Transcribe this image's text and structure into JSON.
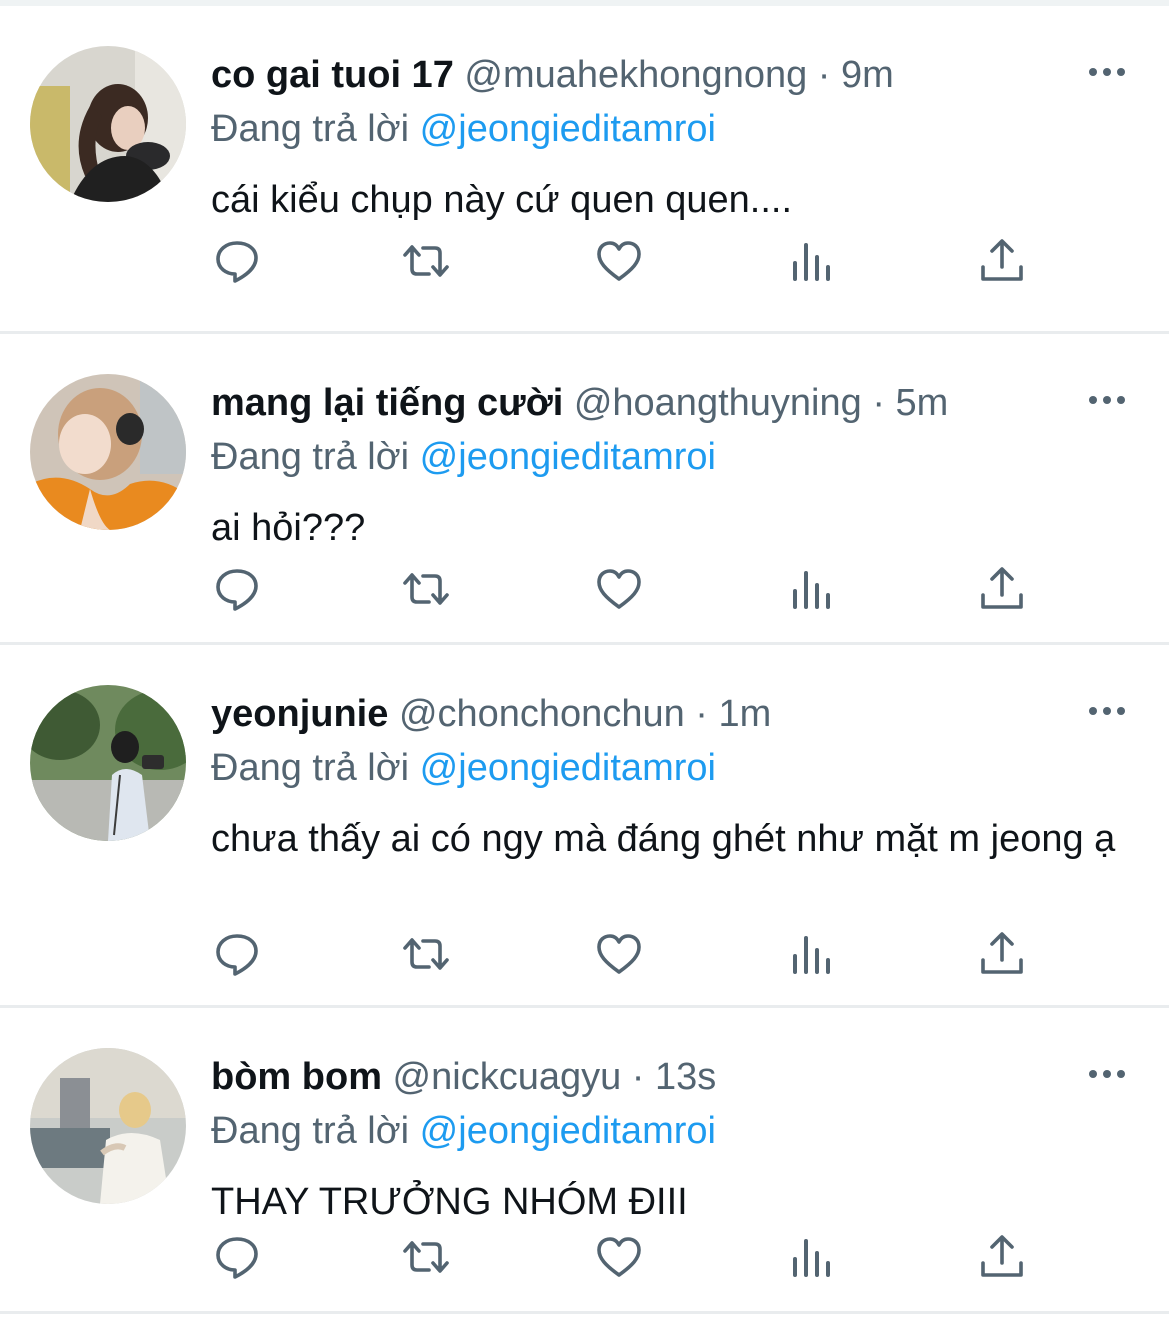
{
  "reply_prefix": "Đang trả lời",
  "tweets": [
    {
      "display_name": "co gai tuoi 17",
      "handle": "@muahekhongnong",
      "separator": "·",
      "time": "9m",
      "reply_to": "@jeongieditamroi",
      "text": "cái kiểu chụp này cứ quen quen....",
      "avatar": "avatar-girl-ponytail"
    },
    {
      "display_name": "mang lại tiếng cười",
      "handle": "@hoangthuyning",
      "separator": "·",
      "time": "5m",
      "reply_to": "@jeongieditamroi",
      "text": "ai hỏi???",
      "avatar": "avatar-girl-orange"
    },
    {
      "display_name": "yeonjunie",
      "handle": "@chonchonchun",
      "separator": "·",
      "time": "1m",
      "reply_to": "@jeongieditamroi",
      "text": "chưa thấy ai có ngy mà đáng ghét như mặt m jeong ạ",
      "avatar": "avatar-person-camera"
    },
    {
      "display_name": "bòm bom",
      "handle": "@nickcuagyu",
      "separator": "·",
      "time": "13s",
      "reply_to": "@jeongieditamroi",
      "text": "THAY TRƯỞNG NHÓM ĐIII",
      "avatar": "avatar-person-waterfront"
    }
  ],
  "icons": {
    "reply": "reply-icon",
    "retweet": "retweet-icon",
    "like": "heart-icon",
    "views": "analytics-icon",
    "share": "share-icon",
    "more": "more-options-icon"
  },
  "colors": {
    "text": "#0f1419",
    "secondary": "#536471",
    "link": "#1d9bf0",
    "divider": "#e9ecee"
  }
}
